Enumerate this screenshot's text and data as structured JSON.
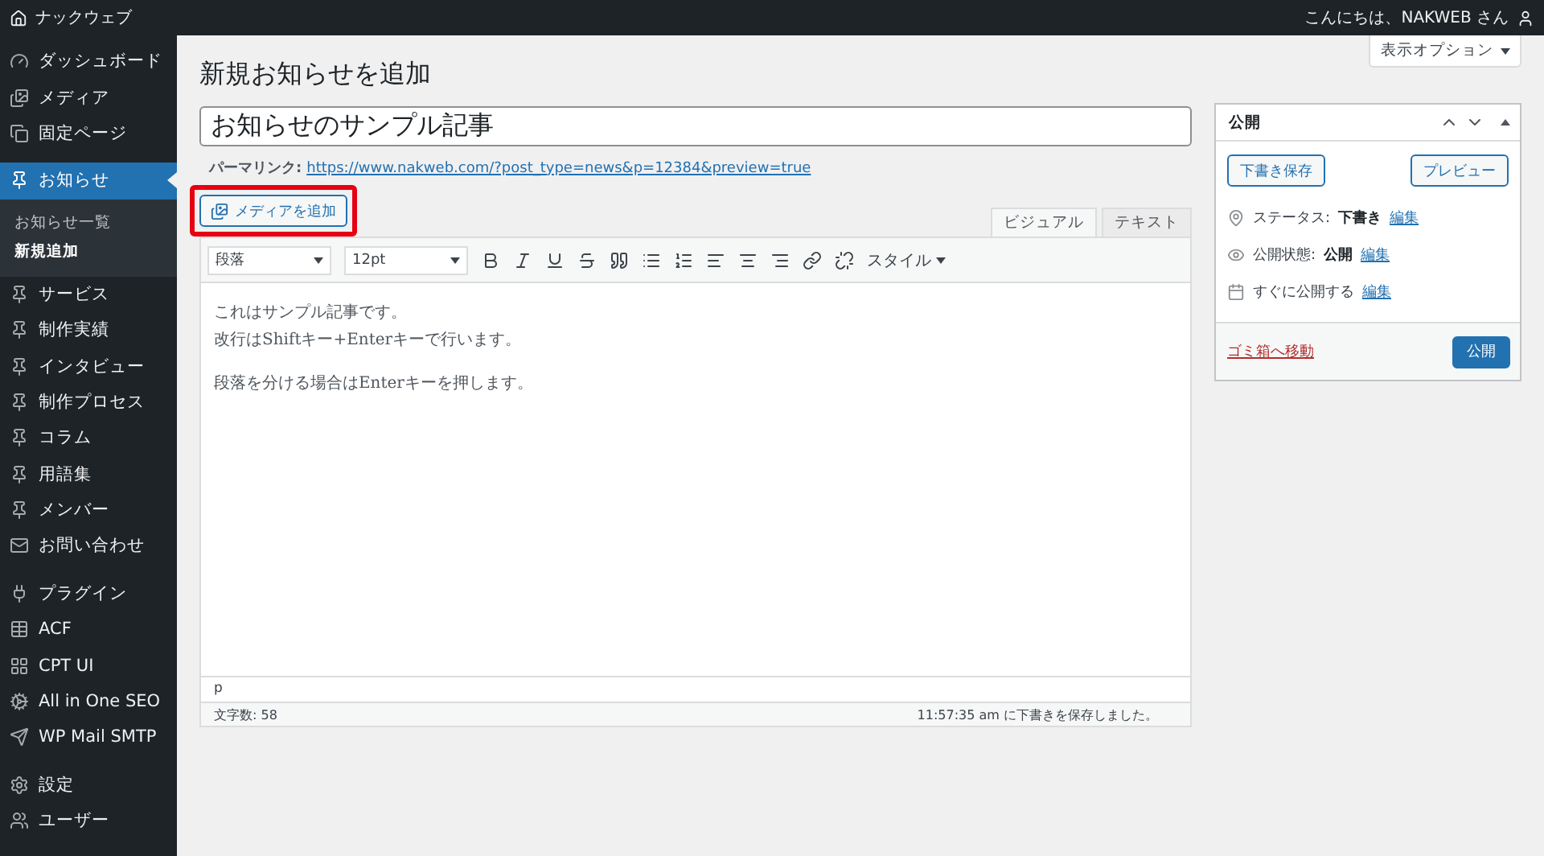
{
  "admin_bar": {
    "site_name": "ナックウェブ",
    "greeting": "こんにちは、NAKWEB さん"
  },
  "sidebar": {
    "groups": [
      {
        "items": [
          {
            "label": "ダッシュボード",
            "selected": false
          },
          {
            "label": "メディア",
            "selected": false
          },
          {
            "label": "固定ページ",
            "selected": false
          }
        ]
      },
      {
        "items": [
          {
            "label": "お知らせ",
            "selected": true,
            "children": [
              {
                "label": "お知らせ一覧",
                "selected": false
              },
              {
                "label": "新規追加",
                "selected": true
              }
            ]
          },
          {
            "label": "サービス",
            "selected": false
          },
          {
            "label": "制作実績",
            "selected": false
          },
          {
            "label": "インタビュー",
            "selected": false
          },
          {
            "label": "制作プロセス",
            "selected": false
          },
          {
            "label": "コラム",
            "selected": false
          },
          {
            "label": "用語集",
            "selected": false
          },
          {
            "label": "メンバー",
            "selected": false
          },
          {
            "label": "お問い合わせ",
            "selected": false
          }
        ]
      },
      {
        "items": [
          {
            "label": "プラグイン",
            "selected": false
          },
          {
            "label": "ACF",
            "selected": false
          },
          {
            "label": "CPT UI",
            "selected": false
          },
          {
            "label": "All in One SEO",
            "selected": false
          },
          {
            "label": "WP Mail SMTP",
            "selected": false
          }
        ]
      },
      {
        "items": [
          {
            "label": "設定",
            "selected": false
          },
          {
            "label": "ユーザー",
            "selected": false
          }
        ]
      }
    ]
  },
  "screen_options": "表示オプション",
  "page_title": "新規お知らせを追加",
  "post_title": "お知らせのサンプル記事",
  "permalink": {
    "label": "パーマリンク:",
    "url": "https://www.nakweb.com/?post_type=news&p=12384&preview=true"
  },
  "editor": {
    "media_button": {
      "label": "メディアを追加",
      "highlighted": true
    },
    "tabs": [
      {
        "label": "ビジュアル",
        "selected": true
      },
      {
        "label": "テキスト",
        "selected": false
      }
    ],
    "format_select": "段落",
    "size_select": "12pt",
    "style_menu": "スタイル",
    "paragraphs": [
      [
        "これはサンプル記事です。",
        "改行はShiftキー+Enterキーで行います。"
      ],
      [
        "段落を分ける場合はEnterキーを押します。"
      ]
    ],
    "path": "p",
    "word_count": "文字数: 58",
    "autosave": "11:57:35 am に下書きを保存しました。"
  },
  "publish_box": {
    "title": "公開",
    "save_draft": "下書き保存",
    "preview": "プレビュー",
    "rows": [
      {
        "label": "ステータス:",
        "value": "下書き",
        "link": "編集"
      },
      {
        "label": "公開状態:",
        "value": "公開",
        "link": "編集"
      },
      {
        "label": "すぐに公開する",
        "value": "",
        "link": "編集"
      }
    ],
    "trash": "ゴミ箱へ移動",
    "publish": "公開"
  }
}
